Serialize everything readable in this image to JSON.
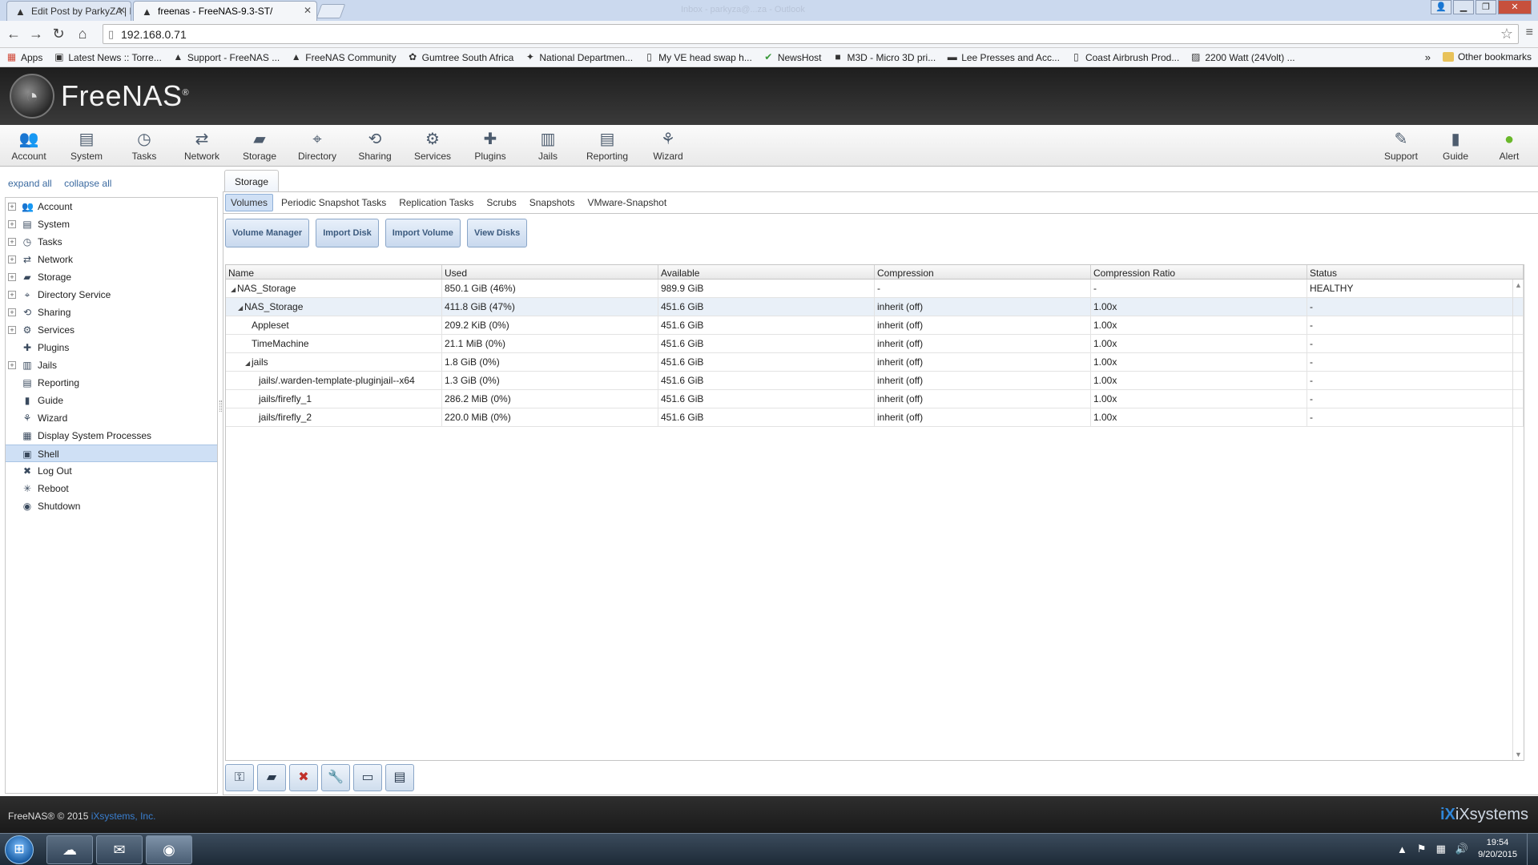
{
  "browser": {
    "tabs": [
      {
        "title": "Edit Post by ParkyZA | Fre",
        "active": false
      },
      {
        "title": "freenas - FreeNAS-9.3-ST/",
        "active": true
      }
    ],
    "window_title": "Inbox - parkyza@...za - Outlook",
    "url": "192.168.0.71",
    "bookmarks": [
      {
        "label": "Apps",
        "icon": "apps-grid-icon"
      },
      {
        "label": "Latest News :: Torre...",
        "icon": "news-icon"
      },
      {
        "label": "Support - FreeNAS ...",
        "icon": "freenas-shark-icon"
      },
      {
        "label": "FreeNAS Community",
        "icon": "freenas-shark-icon"
      },
      {
        "label": "Gumtree South Africa",
        "icon": "gumtree-icon"
      },
      {
        "label": "National Departmen...",
        "icon": "gov-crest-icon"
      },
      {
        "label": "My VE head swap h...",
        "icon": "page-icon"
      },
      {
        "label": "NewsHost",
        "icon": "newshost-icon"
      },
      {
        "label": "M3D - Micro 3D pri...",
        "icon": "m3d-icon"
      },
      {
        "label": "Lee Presses and Acc...",
        "icon": "flag-icon"
      },
      {
        "label": "Coast Airbrush Prod...",
        "icon": "page-icon"
      },
      {
        "label": "2200 Watt (24Volt) ...",
        "icon": "image-icon"
      }
    ],
    "bookmarks_more": "»",
    "other_bookmarks": "Other bookmarks"
  },
  "app": {
    "brand": "FreeNAS",
    "topnav": [
      {
        "label": "Account",
        "icon": "account-icon"
      },
      {
        "label": "System",
        "icon": "system-icon"
      },
      {
        "label": "Tasks",
        "icon": "tasks-icon"
      },
      {
        "label": "Network",
        "icon": "network-icon"
      },
      {
        "label": "Storage",
        "icon": "storage-icon"
      },
      {
        "label": "Directory",
        "icon": "directory-icon"
      },
      {
        "label": "Sharing",
        "icon": "sharing-icon"
      },
      {
        "label": "Services",
        "icon": "services-icon"
      },
      {
        "label": "Plugins",
        "icon": "plugins-icon"
      },
      {
        "label": "Jails",
        "icon": "jails-icon"
      },
      {
        "label": "Reporting",
        "icon": "reporting-icon"
      },
      {
        "label": "Wizard",
        "icon": "wizard-icon"
      }
    ],
    "topnav_right": [
      {
        "label": "Support",
        "icon": "support-icon"
      },
      {
        "label": "Guide",
        "icon": "guide-icon"
      },
      {
        "label": "Alert",
        "icon": "alert-icon"
      }
    ],
    "tree_actions": {
      "expand": "expand all",
      "collapse": "collapse all"
    },
    "tree": [
      {
        "label": "Account",
        "expandable": true,
        "icon": "account-icon"
      },
      {
        "label": "System",
        "expandable": true,
        "icon": "system-icon"
      },
      {
        "label": "Tasks",
        "expandable": true,
        "icon": "tasks-icon"
      },
      {
        "label": "Network",
        "expandable": true,
        "icon": "network-icon"
      },
      {
        "label": "Storage",
        "expandable": true,
        "icon": "storage-icon"
      },
      {
        "label": "Directory Service",
        "expandable": true,
        "icon": "directory-icon"
      },
      {
        "label": "Sharing",
        "expandable": true,
        "icon": "sharing-icon"
      },
      {
        "label": "Services",
        "expandable": true,
        "icon": "services-icon"
      },
      {
        "label": "Plugins",
        "expandable": false,
        "icon": "plugins-icon"
      },
      {
        "label": "Jails",
        "expandable": true,
        "icon": "jails-icon"
      },
      {
        "label": "Reporting",
        "expandable": false,
        "icon": "reporting-icon"
      },
      {
        "label": "Guide",
        "expandable": false,
        "icon": "guide-icon"
      },
      {
        "label": "Wizard",
        "expandable": false,
        "icon": "wizard-icon"
      },
      {
        "label": "Display System Processes",
        "expandable": false,
        "icon": "processes-icon"
      },
      {
        "label": "Shell",
        "expandable": false,
        "icon": "shell-icon",
        "selected": true
      },
      {
        "label": "Log Out",
        "expandable": false,
        "icon": "logout-icon"
      },
      {
        "label": "Reboot",
        "expandable": false,
        "icon": "reboot-icon"
      },
      {
        "label": "Shutdown",
        "expandable": false,
        "icon": "shutdown-icon"
      }
    ],
    "main_tab": "Storage",
    "subtabs": [
      "Volumes",
      "Periodic Snapshot Tasks",
      "Replication Tasks",
      "Scrubs",
      "Snapshots",
      "VMware-Snapshot"
    ],
    "active_subtab": "Volumes",
    "action_buttons": [
      "Volume Manager",
      "Import Disk",
      "Import Volume",
      "View Disks"
    ],
    "grid": {
      "columns": [
        "Name",
        "Used",
        "Available",
        "Compression",
        "Compression Ratio",
        "Status"
      ],
      "rows": [
        {
          "level": 0,
          "expanded": true,
          "name": "NAS_Storage",
          "used": "850.1 GiB (46%)",
          "available": "989.9 GiB",
          "compression": "-",
          "ratio": "-",
          "status": "HEALTHY"
        },
        {
          "level": 1,
          "expanded": true,
          "name": "NAS_Storage",
          "used": "411.8 GiB (47%)",
          "available": "451.6 GiB",
          "compression": "inherit (off)",
          "ratio": "1.00x",
          "status": "-",
          "highlight": true
        },
        {
          "level": 2,
          "name": "Appleset",
          "used": "209.2 KiB (0%)",
          "available": "451.6 GiB",
          "compression": "inherit (off)",
          "ratio": "1.00x",
          "status": "-"
        },
        {
          "level": 2,
          "name": "TimeMachine",
          "used": "21.1 MiB (0%)",
          "available": "451.6 GiB",
          "compression": "inherit (off)",
          "ratio": "1.00x",
          "status": "-"
        },
        {
          "level": 2,
          "expanded": true,
          "name": "jails",
          "used": "1.8 GiB (0%)",
          "available": "451.6 GiB",
          "compression": "inherit (off)",
          "ratio": "1.00x",
          "status": "-"
        },
        {
          "level": 3,
          "name": "jails/.warden-template-pluginjail--x64",
          "used": "1.3 GiB (0%)",
          "available": "451.6 GiB",
          "compression": "inherit (off)",
          "ratio": "1.00x",
          "status": "-"
        },
        {
          "level": 3,
          "name": "jails/firefly_1",
          "used": "286.2 MiB (0%)",
          "available": "451.6 GiB",
          "compression": "inherit (off)",
          "ratio": "1.00x",
          "status": "-"
        },
        {
          "level": 3,
          "name": "jails/firefly_2",
          "used": "220.0 MiB (0%)",
          "available": "451.6 GiB",
          "compression": "inherit (off)",
          "ratio": "1.00x",
          "status": "-"
        }
      ]
    },
    "bottom_tools": [
      "change-permissions-icon",
      "create-dataset-icon",
      "detach-volume-icon",
      "scrub-volume-icon",
      "create-zvol-icon",
      "volume-status-icon"
    ],
    "footer": {
      "copyright": "FreeNAS® © 2015",
      "company": "iXsystems, Inc.",
      "logo": "iXsystems"
    }
  },
  "taskbar": {
    "apps": [
      "explorer-icon",
      "outlook-icon",
      "chrome-icon"
    ],
    "time": "19:54",
    "date": "9/20/2015"
  },
  "colors": {
    "accent": "#3b6aa0",
    "selection": "#cfe0f5",
    "header_dark": "#2a2a2a"
  }
}
